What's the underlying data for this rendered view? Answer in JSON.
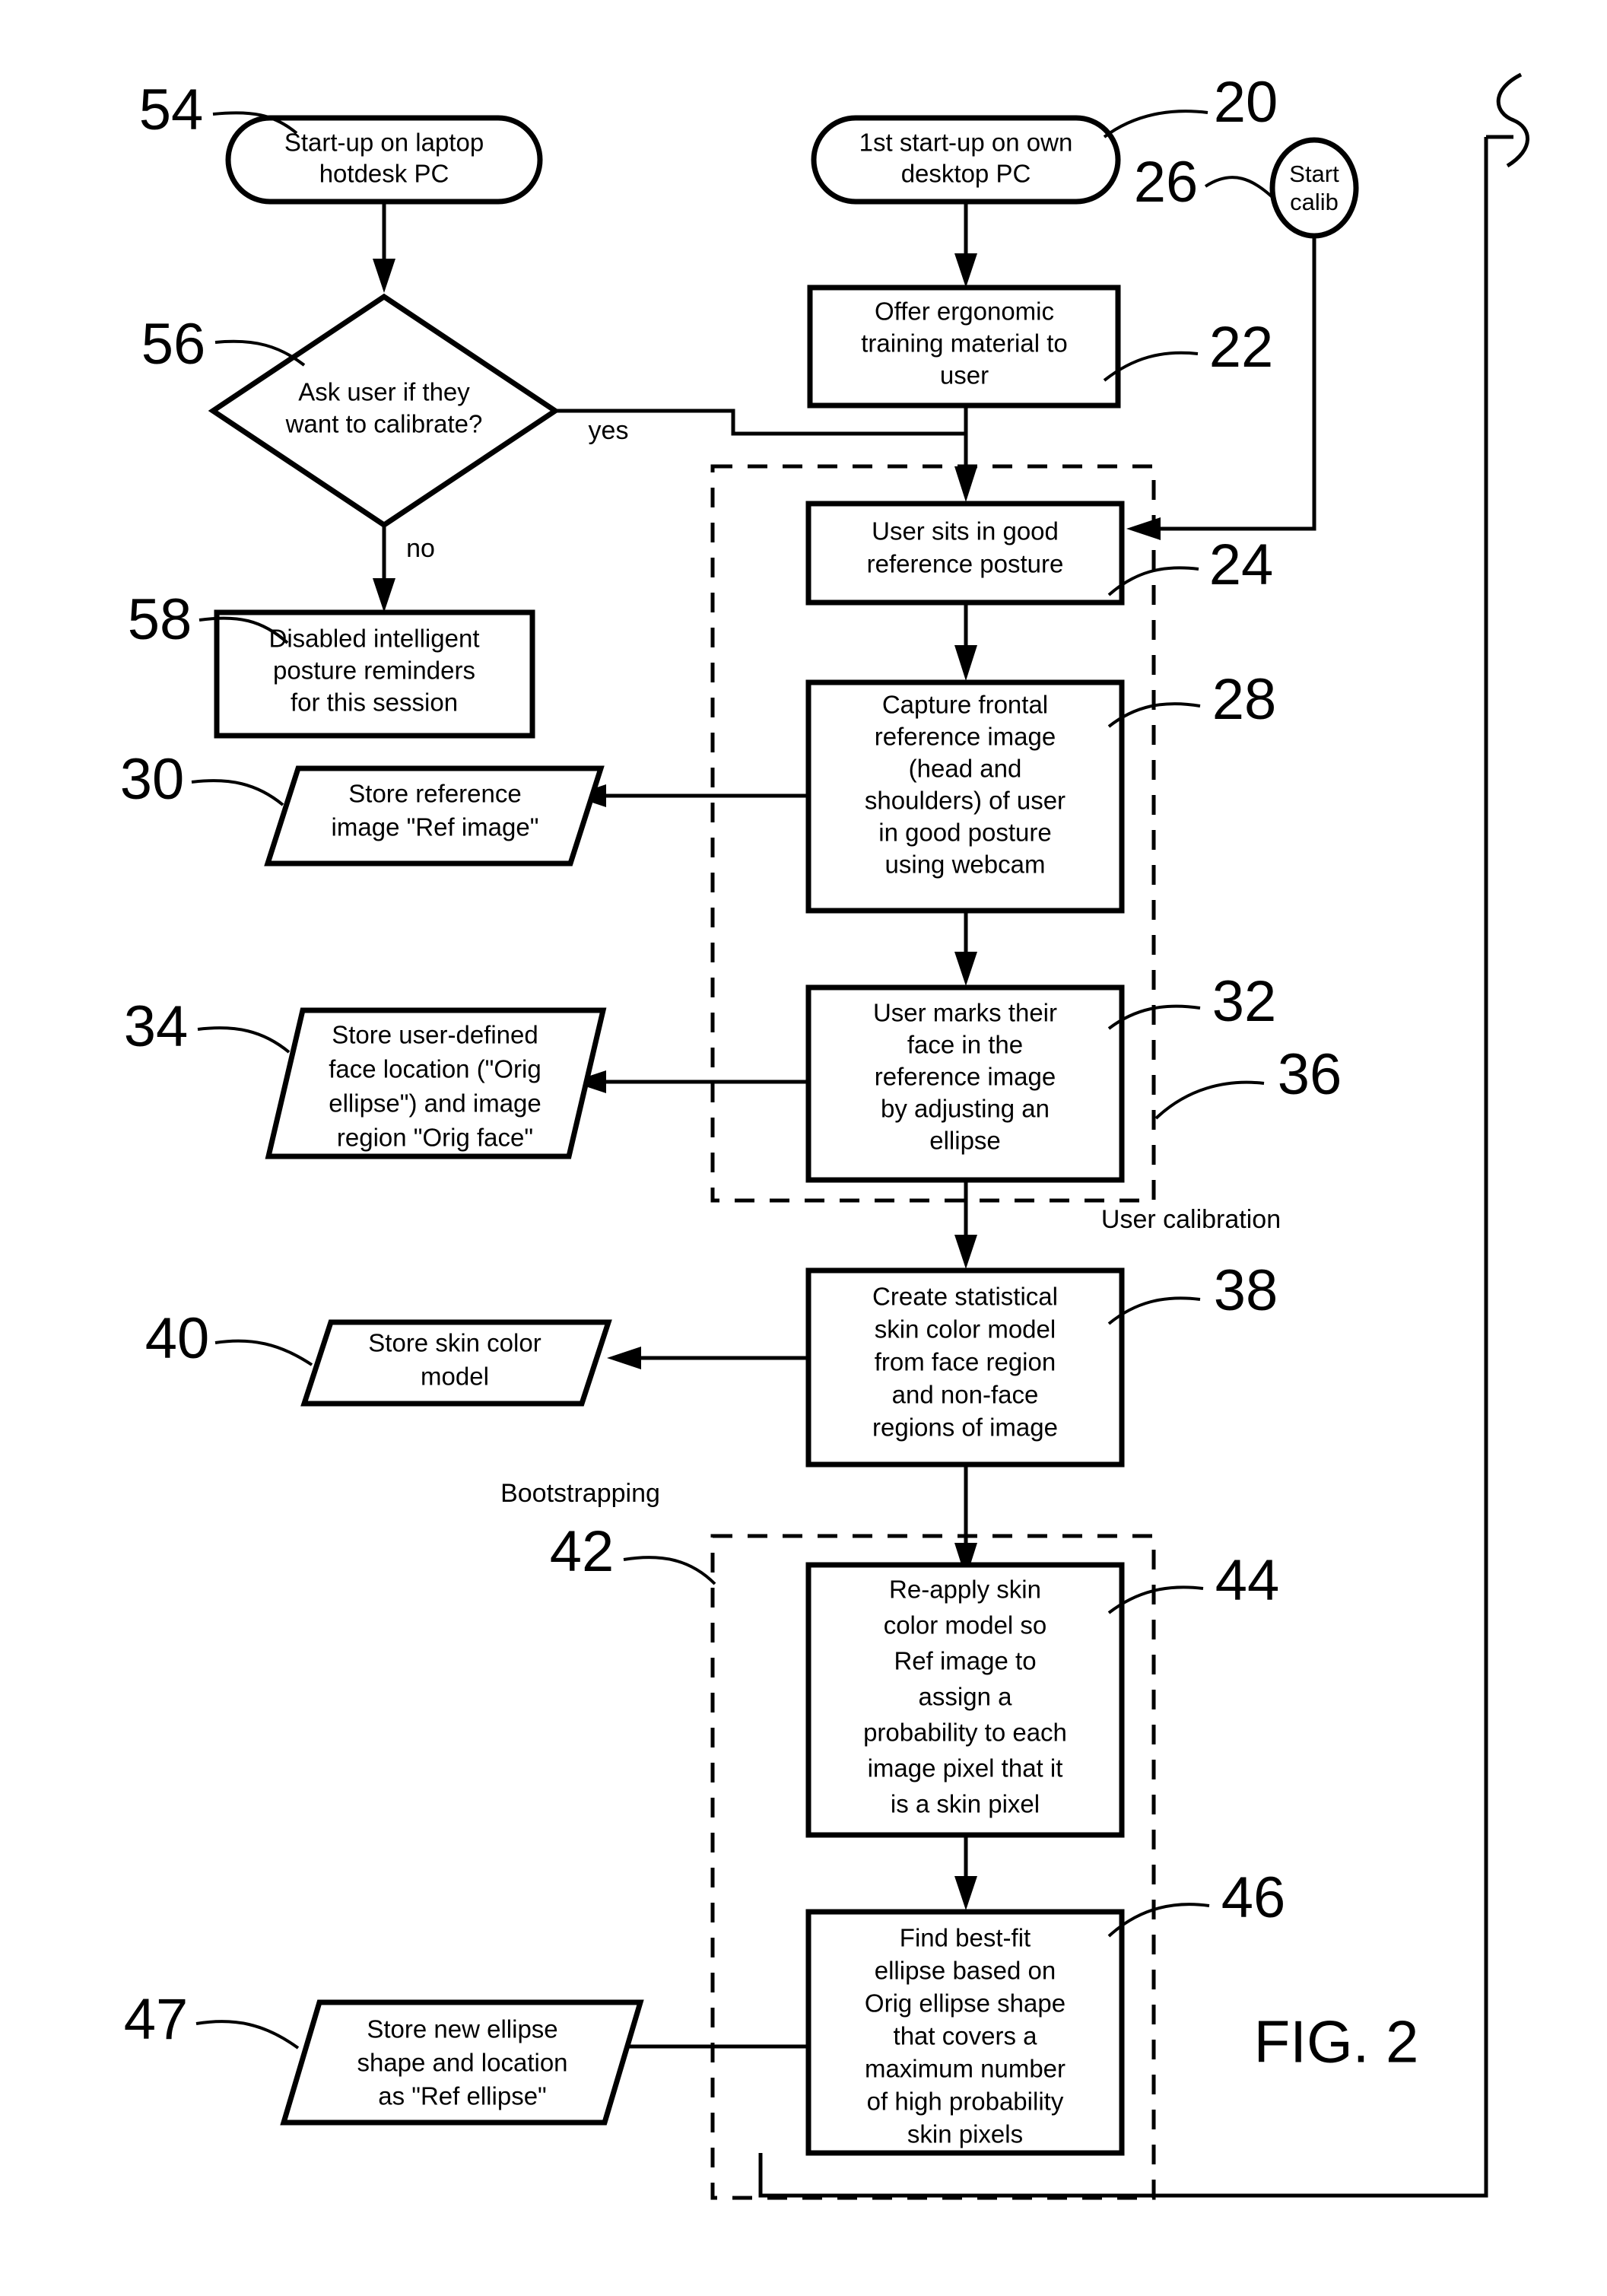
{
  "figure": {
    "label": "FIG. 2",
    "title": "Posture calibration flowchart"
  },
  "nodes": {
    "n54": {
      "ref": "54",
      "shape": "terminator",
      "lines": [
        "Start-up on laptop",
        "hotdesk PC"
      ]
    },
    "n56": {
      "ref": "56",
      "shape": "decision",
      "lines": [
        "Ask user if they",
        "want to calibrate?"
      ]
    },
    "n58": {
      "ref": "58",
      "shape": "process",
      "lines": [
        "Disabled intelligent",
        "posture reminders",
        "for this session"
      ]
    },
    "n20": {
      "ref": "20",
      "shape": "terminator",
      "lines": [
        "1st start-up on own",
        "desktop PC"
      ]
    },
    "n26": {
      "ref": "26",
      "shape": "connector-circle",
      "lines": [
        "Start",
        "calib"
      ]
    },
    "n22": {
      "ref": "22",
      "shape": "process",
      "lines": [
        "Offer ergonomic",
        "training material to",
        "user"
      ]
    },
    "n24": {
      "ref": "24",
      "shape": "process",
      "lines": [
        "User sits in good",
        "reference posture"
      ]
    },
    "n28": {
      "ref": "28",
      "shape": "process",
      "lines": [
        "Capture frontal",
        "reference image",
        "(head and",
        "shoulders) of user",
        "in good posture",
        "using webcam"
      ]
    },
    "n30": {
      "ref": "30",
      "shape": "data",
      "lines": [
        "Store reference",
        "image \"Ref image\""
      ]
    },
    "n32": {
      "ref": "32",
      "shape": "process",
      "lines": [
        "User marks their",
        "face in the",
        "reference image",
        "by adjusting an",
        "ellipse"
      ]
    },
    "n34": {
      "ref": "34",
      "shape": "data",
      "lines": [
        "Store user-defined",
        "face location (\"Orig",
        "ellipse\") and image",
        "region \"Orig face\""
      ]
    },
    "n36": {
      "ref": "36",
      "shape": "group-pointer",
      "lines": []
    },
    "n38": {
      "ref": "38",
      "shape": "process",
      "lines": [
        "Create statistical",
        "skin color model",
        "from face region",
        "and non-face",
        "regions of image"
      ]
    },
    "n40": {
      "ref": "40",
      "shape": "data",
      "lines": [
        "Store skin color",
        "model"
      ]
    },
    "n42": {
      "ref": "42",
      "shape": "group-pointer",
      "lines": []
    },
    "n44": {
      "ref": "44",
      "shape": "process",
      "lines": [
        "Re-apply skin",
        "color model so",
        "Ref image to",
        "assign a",
        "probability to each",
        "image pixel that it",
        "is a skin pixel"
      ]
    },
    "n46": {
      "ref": "46",
      "shape": "process",
      "lines": [
        "Find best-fit",
        "ellipse based on",
        "Orig ellipse shape",
        "that covers a",
        "maximum number",
        "of high probability",
        "skin pixels"
      ]
    },
    "n47": {
      "ref": "47",
      "shape": "data",
      "lines": [
        "Store new ellipse",
        "shape and location",
        "as \"Ref ellipse\""
      ]
    }
  },
  "edge_labels": {
    "yes": "yes",
    "no": "no"
  },
  "group_labels": {
    "user_calibration": "User calibration",
    "bootstrapping": "Bootstrapping"
  },
  "colors": {
    "stroke": "#000000",
    "fill": "#ffffff"
  }
}
